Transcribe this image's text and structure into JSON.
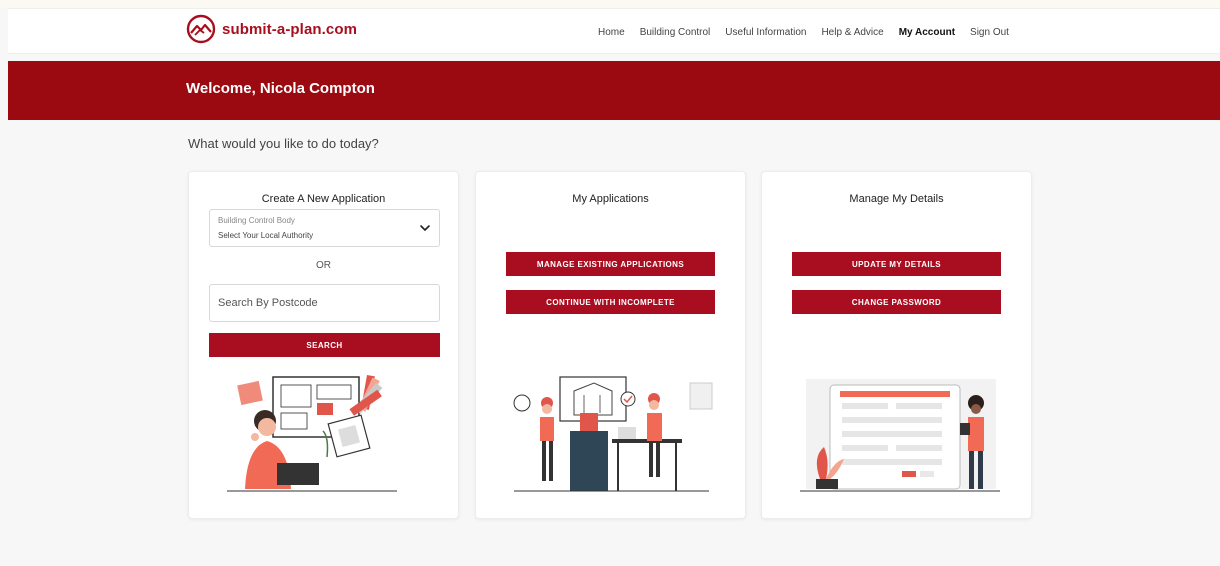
{
  "brand": {
    "name_part1": "submit",
    "name_part2": "-a-plan.com",
    "accent": "#9c0a11"
  },
  "nav": {
    "items": [
      {
        "label": "Home"
      },
      {
        "label": "Building Control"
      },
      {
        "label": "Useful Information"
      },
      {
        "label": "Help & Advice"
      },
      {
        "label": "My Account"
      },
      {
        "label": "Sign Out"
      }
    ]
  },
  "banner": {
    "title": "Welcome, Nicola Compton"
  },
  "prompt": "What would you like to do today?",
  "cards": {
    "create": {
      "title": "Create A New Application",
      "select_label": "Building Control Body",
      "select_value": "Select Your Local Authority",
      "or_text": "OR",
      "postcode_placeholder": "Search By Postcode",
      "search_label": "SEARCH",
      "illustration_icon": "architect-drawing-illustration"
    },
    "applications": {
      "title": "My Applications",
      "manage_label": "MANAGE EXISTING APPLICATIONS",
      "continue_label": "CONTINUE WITH INCOMPLETE",
      "illustration_icon": "construction-team-illustration"
    },
    "details": {
      "title": "Manage My Details",
      "update_label": "UPDATE MY DETAILS",
      "password_label": "CHANGE PASSWORD",
      "illustration_icon": "online-form-illustration"
    }
  }
}
